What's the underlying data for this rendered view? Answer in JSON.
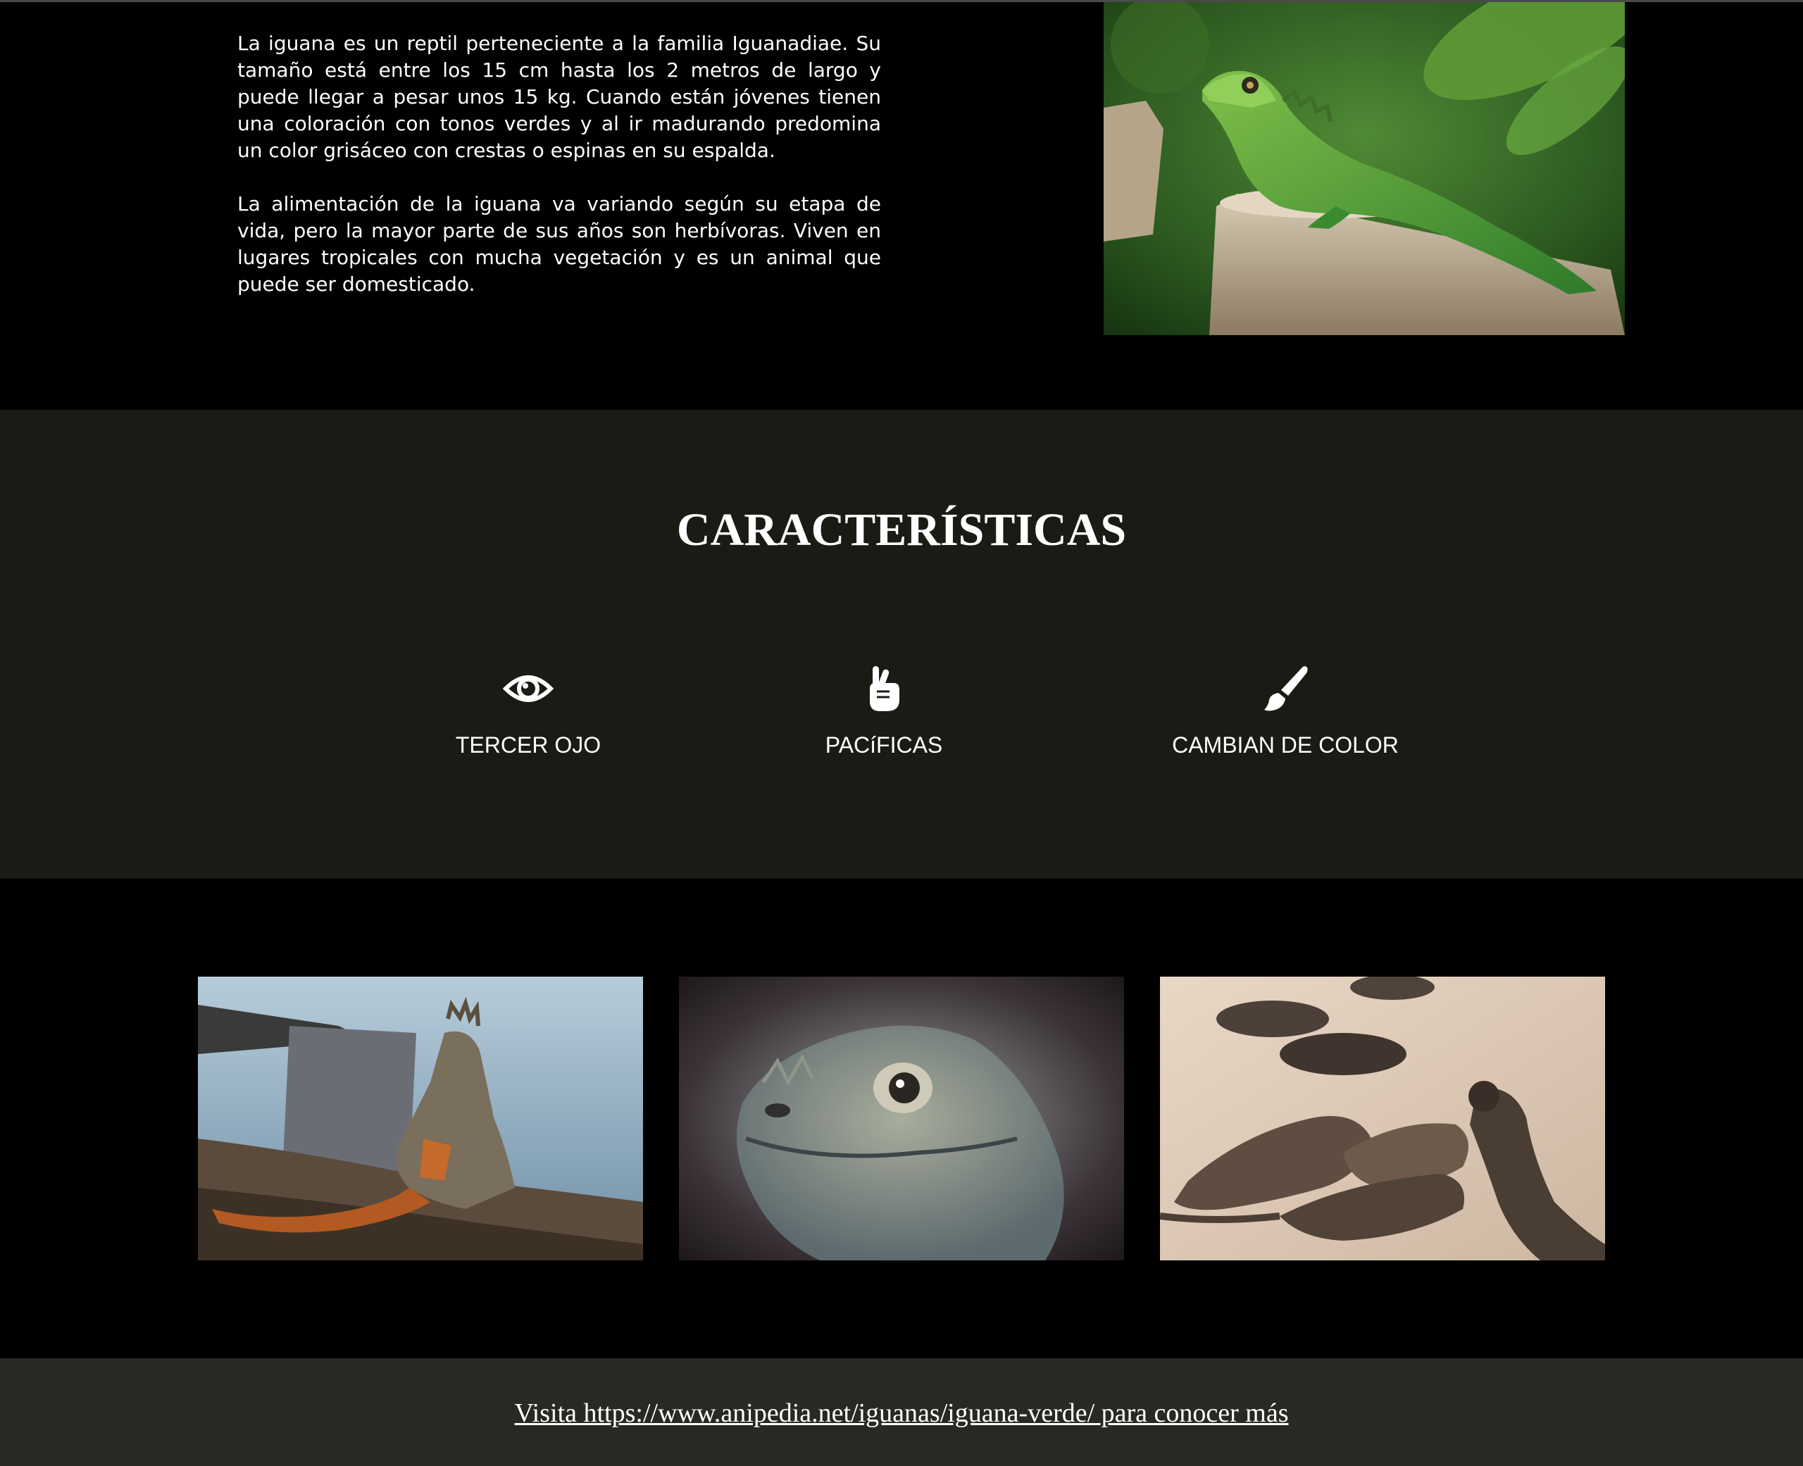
{
  "intro": {
    "paragraph1": "La iguana es un reptil perteneciente a la familia Iguanadiae. Su tamaño está entre los 15 cm hasta los 2 metros de largo y puede llegar a pesar unos 15 kg. Cuando están jóvenes tienen una coloración con tonos verdes y al ir madurando predomina un color grisáceo con crestas o espinas en su espalda.",
    "paragraph2": "La alimentación de la iguana va variando según su etapa de vida, pero la mayor parte de sus años son herbívoras. Viven en lugares tropicales con mucha vegetación y es un animal que puede ser domesticado.",
    "hero_image": "green-iguana-on-stump-photo"
  },
  "features": {
    "title": "CARACTERÍSTICAS",
    "items": [
      {
        "icon": "eye-icon",
        "label": "TERCER OJO"
      },
      {
        "icon": "peace-hand-icon",
        "label": "PACíFICAS"
      },
      {
        "icon": "paintbrush-icon",
        "label": "CAMBIAN DE COLOR"
      }
    ]
  },
  "gallery": {
    "images": [
      "iguana-by-water-photo",
      "iguana-head-closeup-photo",
      "iguanas-on-sand-photo"
    ]
  },
  "footer": {
    "link_text": "Visita https://www.anipedia.net/iguanas/iguana-verde/ para conocer más"
  },
  "colors": {
    "background": "#000000",
    "features_bg": "#1c1a15",
    "footer_bg": "#2a2824",
    "text": "#ffffff"
  }
}
